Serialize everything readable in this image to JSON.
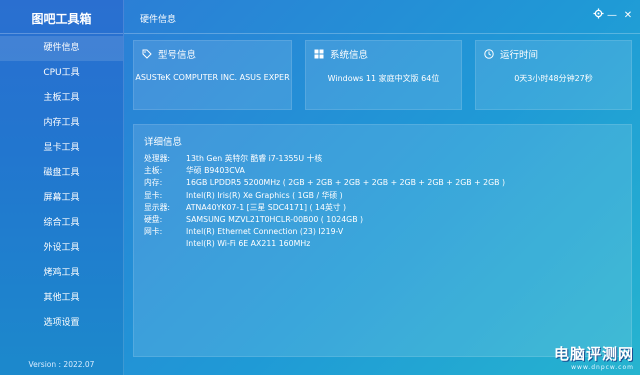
{
  "app": {
    "title": "图吧工具箱",
    "version": "Version : 2022.07"
  },
  "nav": [
    {
      "label": "硬件信息"
    },
    {
      "label": "CPU工具"
    },
    {
      "label": "主板工具"
    },
    {
      "label": "内存工具"
    },
    {
      "label": "显卡工具"
    },
    {
      "label": "磁盘工具"
    },
    {
      "label": "屏幕工具"
    },
    {
      "label": "综合工具"
    },
    {
      "label": "外设工具"
    },
    {
      "label": "烤鸡工具"
    },
    {
      "label": "其他工具"
    },
    {
      "label": "选项设置"
    }
  ],
  "window": {
    "title": "硬件信息",
    "settings_icon": "gear-icon",
    "minimize": "—",
    "close": "✕"
  },
  "cards": {
    "model": {
      "label": "型号信息",
      "value": "ASUSTeK COMPUTER INC. ASUS EXPER",
      "icon": "tag-icon"
    },
    "system": {
      "label": "系统信息",
      "value": "Windows 11 家庭中文版 64位",
      "icon": "windows-logo-icon"
    },
    "uptime": {
      "label": "运行时间",
      "value": "0天3小时48分钟27秒",
      "icon": "clock-icon"
    }
  },
  "details": {
    "title": "详细信息",
    "rows": [
      {
        "key": "处理器:",
        "value": "13th Gen 英特尔 酷睿 i7-1355U 十核"
      },
      {
        "key": "主板:",
        "value": "华硕 B9403CVA"
      },
      {
        "key": "内存:",
        "value": "16GB LPDDR5 5200MHz ( 2GB + 2GB + 2GB + 2GB + 2GB + 2GB + 2GB + 2GB )"
      },
      {
        "key": "显卡:",
        "value": "Intel(R) Iris(R) Xe Graphics ( 1GB / 华硕 )"
      },
      {
        "key": "显示器:",
        "value": "ATNA40YK07-1 [三星 SDC4171] ( 14英寸 )"
      },
      {
        "key": "硬盘:",
        "value": "SAMSUNG MZVL21T0HCLR-00B00 ( 1024GB )"
      },
      {
        "key": "网卡:",
        "value": "Intel(R) Ethernet Connection (23) I219-V"
      },
      {
        "key": "",
        "value": "Intel(R) Wi-Fi 6E AX211 160MHz"
      }
    ]
  },
  "watermark": {
    "title": "电脑评测网",
    "url": "www.dnpcw.com"
  }
}
